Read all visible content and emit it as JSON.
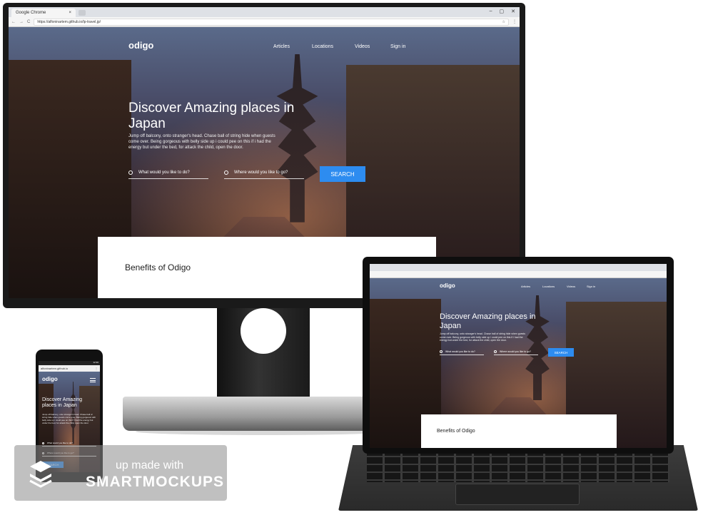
{
  "browser": {
    "tab_title": "Google Chrome",
    "tab_close": "×",
    "url": "https://alfoninartem.github.io/lp-travel.jp/",
    "window_controls": [
      "–",
      "▢",
      "✕"
    ],
    "nav_back": "←",
    "nav_forward": "→",
    "nav_reload": "C",
    "menu": "⋮",
    "star": "☆"
  },
  "site": {
    "logo": "odigo",
    "nav": [
      "Articles",
      "Locations",
      "Videos",
      "Sign in"
    ],
    "hero_title": "Discover Amazing places in Japan",
    "hero_subtitle": "Jump off balcony, onto stranger's head. Chase ball of string hide when guests come over. Being gorgeous with belly side up i could pee on this if i had the energy but under the bed, for attack the child, open the door.",
    "field_what": "What would you like to do?",
    "field_where": "Where would you like to go?",
    "search_label": "SEARCH",
    "benefits_title": "Benefits of Odigo"
  },
  "phone": {
    "status_time": "12:30",
    "url": "alfoninartem.github.io"
  },
  "watermark": {
    "line1": "up made with",
    "line2": "SMARTMOCKUPS"
  }
}
